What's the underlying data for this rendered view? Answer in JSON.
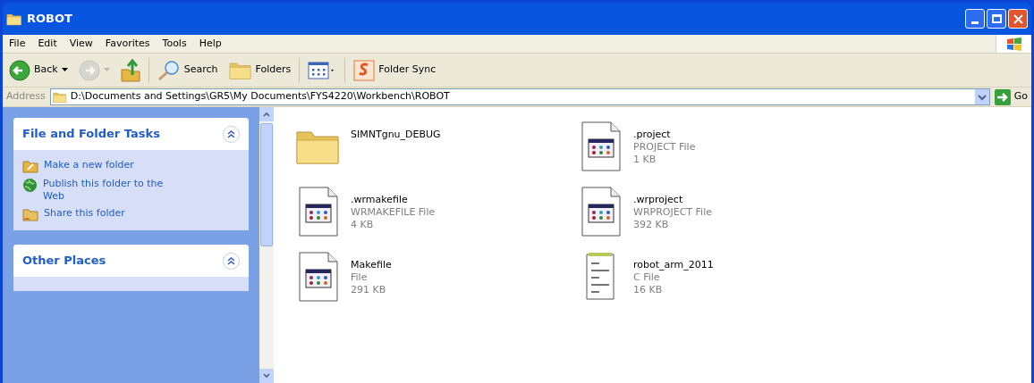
{
  "window": {
    "title": "ROBOT"
  },
  "menu": [
    "File",
    "Edit",
    "View",
    "Favorites",
    "Tools",
    "Help"
  ],
  "toolbar": [
    {
      "kind": "back",
      "label": "Back",
      "disabled": false
    },
    {
      "kind": "forward",
      "disabled": true
    },
    {
      "kind": "up",
      "disabled": false
    },
    {
      "kind": "search",
      "label": "Search",
      "disabled": false
    },
    {
      "kind": "folders",
      "label": "Folders",
      "disabled": false
    },
    {
      "kind": "views",
      "disabled": false
    },
    {
      "kind": "sync",
      "label": "Folder Sync",
      "disabled": false
    }
  ],
  "address": {
    "label": "Address",
    "path": "D:\\Documents and Settings\\GR5\\My Documents\\FYS4220\\Workbench\\ROBOT",
    "go": "Go"
  },
  "sidebar": [
    {
      "title": "File and Folder Tasks",
      "expanded": true,
      "items": [
        {
          "kind": "new-folder",
          "label": "Make a new folder"
        },
        {
          "kind": "globe",
          "label": "Publish this folder to the Web"
        },
        {
          "kind": "share",
          "label": "Share this folder"
        }
      ]
    },
    {
      "title": "Other Places",
      "expanded": true
    }
  ],
  "files": [
    {
      "kind": "folder",
      "name": "SIMNTgnu_DEBUG"
    },
    {
      "kind": "app",
      "name": ".project",
      "type": "PROJECT File",
      "size": "1 KB"
    },
    {
      "kind": "app",
      "name": ".wrmakefile",
      "type": "WRMAKEFILE File",
      "size": "4 KB"
    },
    {
      "kind": "app",
      "name": ".wrproject",
      "type": "WRPROJECT File",
      "size": "392 KB"
    },
    {
      "kind": "app",
      "name": "Makefile",
      "type": "File",
      "size": "291 KB"
    },
    {
      "kind": "text",
      "name": "robot_arm_2011",
      "type": "C File",
      "size": "16 KB"
    }
  ]
}
